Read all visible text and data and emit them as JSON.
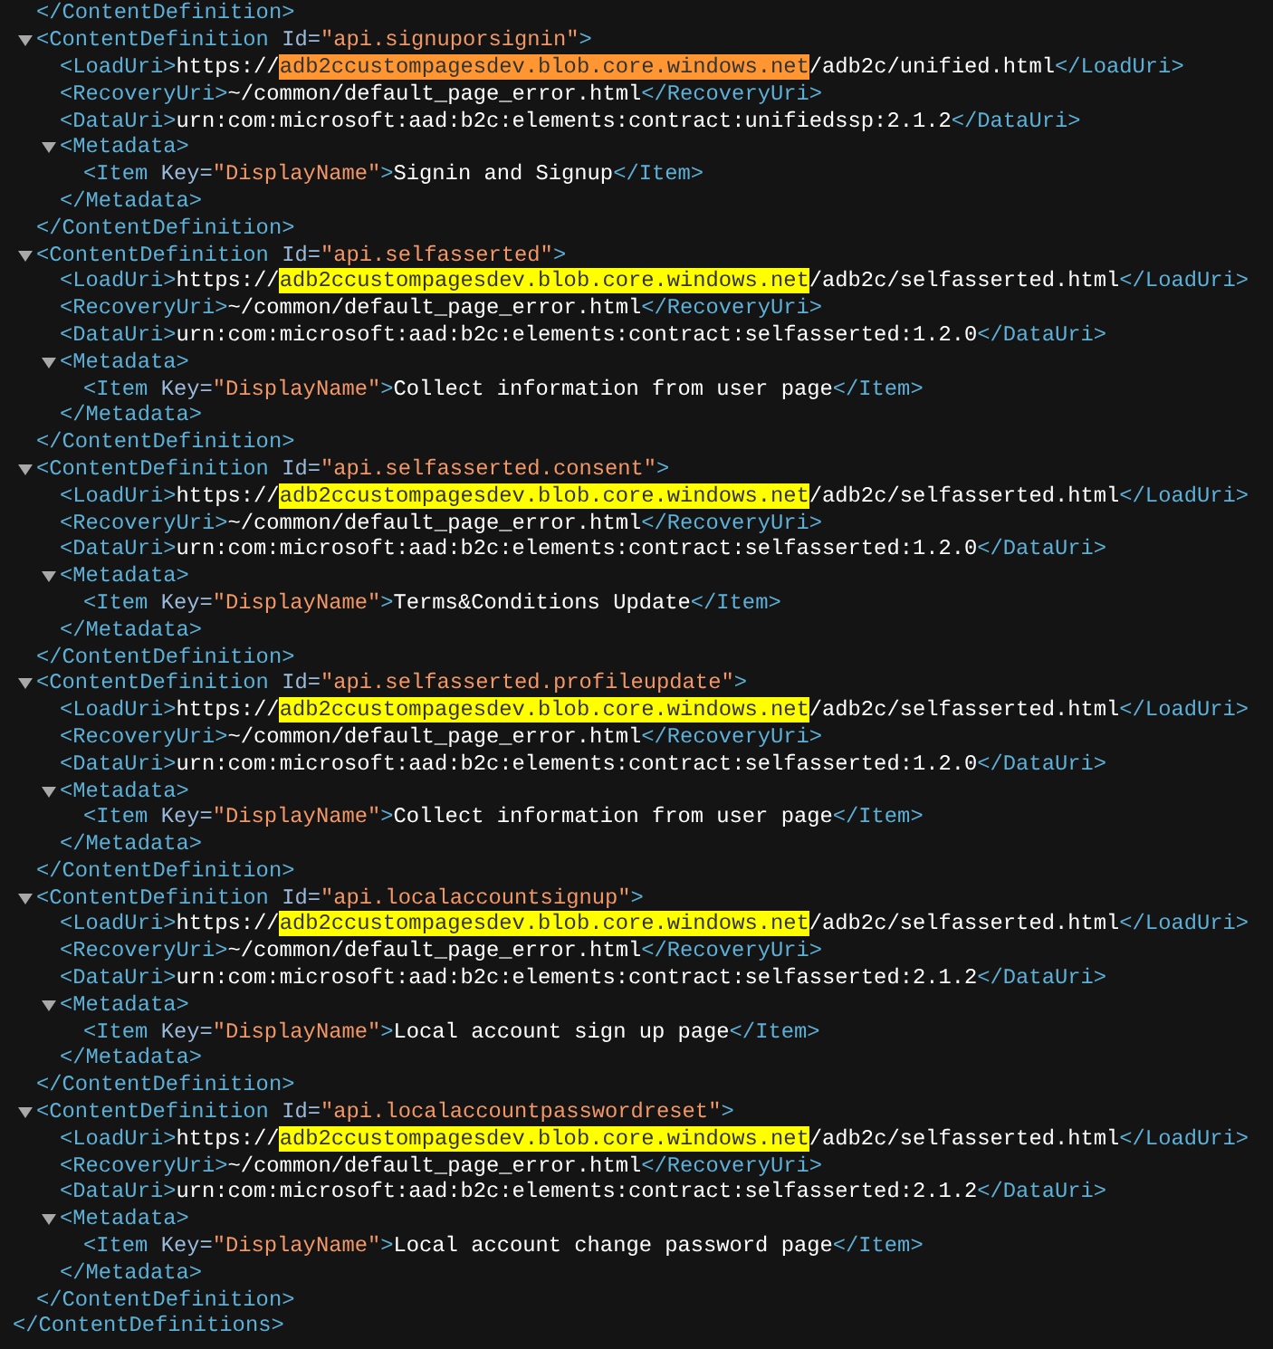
{
  "document": {
    "children": [
      {
        "kind": "line",
        "tokens": [
          {
            "kind": "tag",
            "text": "</ContentDefinition>"
          }
        ]
      },
      {
        "kind": "element",
        "expanded": true,
        "open": [
          {
            "kind": "tag",
            "text": "<ContentDefinition"
          },
          {
            "kind": "attr",
            "text": "Id="
          },
          {
            "kind": "value",
            "text": "\"api.signuporsignin\""
          },
          {
            "kind": "tag",
            "text": ">"
          }
        ],
        "children": [
          {
            "kind": "line",
            "tokens": [
              {
                "kind": "tag",
                "text": "<LoadUri>"
              },
              {
                "kind": "text",
                "text": "https://"
              },
              {
                "kind": "match",
                "text": "adb2ccustompagesdev.blob.core.windows.net",
                "selected": true
              },
              {
                "kind": "text",
                "text": "/adb2c/unified.html"
              },
              {
                "kind": "tag",
                "text": "</LoadUri>"
              }
            ]
          },
          {
            "kind": "line",
            "tokens": [
              {
                "kind": "tag",
                "text": "<RecoveryUri>"
              },
              {
                "kind": "text",
                "text": "~/common/default_page_error.html"
              },
              {
                "kind": "tag",
                "text": "</RecoveryUri>"
              }
            ]
          },
          {
            "kind": "line",
            "tokens": [
              {
                "kind": "tag",
                "text": "<DataUri>"
              },
              {
                "kind": "text",
                "text": "urn:com:microsoft:aad:b2c:elements:contract:unifiedssp:2.1.2"
              },
              {
                "kind": "tag",
                "text": "</DataUri>"
              }
            ]
          },
          {
            "kind": "element",
            "expanded": true,
            "open": [
              {
                "kind": "tag",
                "text": "<Metadata>"
              }
            ],
            "children": [
              {
                "kind": "line",
                "tokens": [
                  {
                    "kind": "tag",
                    "text": "<Item"
                  },
                  {
                    "kind": "attr",
                    "text": "Key="
                  },
                  {
                    "kind": "value",
                    "text": "\"DisplayName\""
                  },
                  {
                    "kind": "tag",
                    "text": ">"
                  },
                  {
                    "kind": "text",
                    "text": "Signin and Signup"
                  },
                  {
                    "kind": "tag",
                    "text": "</Item>"
                  }
                ]
              }
            ],
            "close": [
              {
                "kind": "tag",
                "text": "</Metadata>"
              }
            ]
          }
        ],
        "close": [
          {
            "kind": "tag",
            "text": "</ContentDefinition>"
          }
        ]
      },
      {
        "kind": "element",
        "expanded": true,
        "open": [
          {
            "kind": "tag",
            "text": "<ContentDefinition"
          },
          {
            "kind": "attr",
            "text": "Id="
          },
          {
            "kind": "value",
            "text": "\"api.selfasserted\""
          },
          {
            "kind": "tag",
            "text": ">"
          }
        ],
        "children": [
          {
            "kind": "line",
            "tokens": [
              {
                "kind": "tag",
                "text": "<LoadUri>"
              },
              {
                "kind": "text",
                "text": "https://"
              },
              {
                "kind": "match",
                "text": "adb2ccustompagesdev.blob.core.windows.net",
                "selected": false
              },
              {
                "kind": "text",
                "text": "/adb2c/selfasserted.html"
              },
              {
                "kind": "tag",
                "text": "</LoadUri>"
              }
            ]
          },
          {
            "kind": "line",
            "tokens": [
              {
                "kind": "tag",
                "text": "<RecoveryUri>"
              },
              {
                "kind": "text",
                "text": "~/common/default_page_error.html"
              },
              {
                "kind": "tag",
                "text": "</RecoveryUri>"
              }
            ]
          },
          {
            "kind": "line",
            "tokens": [
              {
                "kind": "tag",
                "text": "<DataUri>"
              },
              {
                "kind": "text",
                "text": "urn:com:microsoft:aad:b2c:elements:contract:selfasserted:1.2.0"
              },
              {
                "kind": "tag",
                "text": "</DataUri>"
              }
            ]
          },
          {
            "kind": "element",
            "expanded": true,
            "open": [
              {
                "kind": "tag",
                "text": "<Metadata>"
              }
            ],
            "children": [
              {
                "kind": "line",
                "tokens": [
                  {
                    "kind": "tag",
                    "text": "<Item"
                  },
                  {
                    "kind": "attr",
                    "text": "Key="
                  },
                  {
                    "kind": "value",
                    "text": "\"DisplayName\""
                  },
                  {
                    "kind": "tag",
                    "text": ">"
                  },
                  {
                    "kind": "text",
                    "text": "Collect information from user page"
                  },
                  {
                    "kind": "tag",
                    "text": "</Item>"
                  }
                ]
              }
            ],
            "close": [
              {
                "kind": "tag",
                "text": "</Metadata>"
              }
            ]
          }
        ],
        "close": [
          {
            "kind": "tag",
            "text": "</ContentDefinition>"
          }
        ]
      },
      {
        "kind": "element",
        "expanded": true,
        "open": [
          {
            "kind": "tag",
            "text": "<ContentDefinition"
          },
          {
            "kind": "attr",
            "text": "Id="
          },
          {
            "kind": "value",
            "text": "\"api.selfasserted.consent\""
          },
          {
            "kind": "tag",
            "text": ">"
          }
        ],
        "children": [
          {
            "kind": "line",
            "tokens": [
              {
                "kind": "tag",
                "text": "<LoadUri>"
              },
              {
                "kind": "text",
                "text": "https://"
              },
              {
                "kind": "match",
                "text": "adb2ccustompagesdev.blob.core.windows.net",
                "selected": false
              },
              {
                "kind": "text",
                "text": "/adb2c/selfasserted.html"
              },
              {
                "kind": "tag",
                "text": "</LoadUri>"
              }
            ]
          },
          {
            "kind": "line",
            "tokens": [
              {
                "kind": "tag",
                "text": "<RecoveryUri>"
              },
              {
                "kind": "text",
                "text": "~/common/default_page_error.html"
              },
              {
                "kind": "tag",
                "text": "</RecoveryUri>"
              }
            ]
          },
          {
            "kind": "line",
            "tokens": [
              {
                "kind": "tag",
                "text": "<DataUri>"
              },
              {
                "kind": "text",
                "text": "urn:com:microsoft:aad:b2c:elements:contract:selfasserted:1.2.0"
              },
              {
                "kind": "tag",
                "text": "</DataUri>"
              }
            ]
          },
          {
            "kind": "element",
            "expanded": true,
            "open": [
              {
                "kind": "tag",
                "text": "<Metadata>"
              }
            ],
            "children": [
              {
                "kind": "line",
                "tokens": [
                  {
                    "kind": "tag",
                    "text": "<Item"
                  },
                  {
                    "kind": "attr",
                    "text": "Key="
                  },
                  {
                    "kind": "value",
                    "text": "\"DisplayName\""
                  },
                  {
                    "kind": "tag",
                    "text": ">"
                  },
                  {
                    "kind": "text",
                    "text": "Terms&Conditions Update"
                  },
                  {
                    "kind": "tag",
                    "text": "</Item>"
                  }
                ]
              }
            ],
            "close": [
              {
                "kind": "tag",
                "text": "</Metadata>"
              }
            ]
          }
        ],
        "close": [
          {
            "kind": "tag",
            "text": "</ContentDefinition>"
          }
        ]
      },
      {
        "kind": "element",
        "expanded": true,
        "open": [
          {
            "kind": "tag",
            "text": "<ContentDefinition"
          },
          {
            "kind": "attr",
            "text": "Id="
          },
          {
            "kind": "value",
            "text": "\"api.selfasserted.profileupdate\""
          },
          {
            "kind": "tag",
            "text": ">"
          }
        ],
        "children": [
          {
            "kind": "line",
            "tokens": [
              {
                "kind": "tag",
                "text": "<LoadUri>"
              },
              {
                "kind": "text",
                "text": "https://"
              },
              {
                "kind": "match",
                "text": "adb2ccustompagesdev.blob.core.windows.net",
                "selected": false
              },
              {
                "kind": "text",
                "text": "/adb2c/selfasserted.html"
              },
              {
                "kind": "tag",
                "text": "</LoadUri>"
              }
            ]
          },
          {
            "kind": "line",
            "tokens": [
              {
                "kind": "tag",
                "text": "<RecoveryUri>"
              },
              {
                "kind": "text",
                "text": "~/common/default_page_error.html"
              },
              {
                "kind": "tag",
                "text": "</RecoveryUri>"
              }
            ]
          },
          {
            "kind": "line",
            "tokens": [
              {
                "kind": "tag",
                "text": "<DataUri>"
              },
              {
                "kind": "text",
                "text": "urn:com:microsoft:aad:b2c:elements:contract:selfasserted:1.2.0"
              },
              {
                "kind": "tag",
                "text": "</DataUri>"
              }
            ]
          },
          {
            "kind": "element",
            "expanded": true,
            "open": [
              {
                "kind": "tag",
                "text": "<Metadata>"
              }
            ],
            "children": [
              {
                "kind": "line",
                "tokens": [
                  {
                    "kind": "tag",
                    "text": "<Item"
                  },
                  {
                    "kind": "attr",
                    "text": "Key="
                  },
                  {
                    "kind": "value",
                    "text": "\"DisplayName\""
                  },
                  {
                    "kind": "tag",
                    "text": ">"
                  },
                  {
                    "kind": "text",
                    "text": "Collect information from user page"
                  },
                  {
                    "kind": "tag",
                    "text": "</Item>"
                  }
                ]
              }
            ],
            "close": [
              {
                "kind": "tag",
                "text": "</Metadata>"
              }
            ]
          }
        ],
        "close": [
          {
            "kind": "tag",
            "text": "</ContentDefinition>"
          }
        ]
      },
      {
        "kind": "element",
        "expanded": true,
        "open": [
          {
            "kind": "tag",
            "text": "<ContentDefinition"
          },
          {
            "kind": "attr",
            "text": "Id="
          },
          {
            "kind": "value",
            "text": "\"api.localaccountsignup\""
          },
          {
            "kind": "tag",
            "text": ">"
          }
        ],
        "children": [
          {
            "kind": "line",
            "tokens": [
              {
                "kind": "tag",
                "text": "<LoadUri>"
              },
              {
                "kind": "text",
                "text": "https://"
              },
              {
                "kind": "match",
                "text": "adb2ccustompagesdev.blob.core.windows.net",
                "selected": false
              },
              {
                "kind": "text",
                "text": "/adb2c/selfasserted.html"
              },
              {
                "kind": "tag",
                "text": "</LoadUri>"
              }
            ]
          },
          {
            "kind": "line",
            "tokens": [
              {
                "kind": "tag",
                "text": "<RecoveryUri>"
              },
              {
                "kind": "text",
                "text": "~/common/default_page_error.html"
              },
              {
                "kind": "tag",
                "text": "</RecoveryUri>"
              }
            ]
          },
          {
            "kind": "line",
            "tokens": [
              {
                "kind": "tag",
                "text": "<DataUri>"
              },
              {
                "kind": "text",
                "text": "urn:com:microsoft:aad:b2c:elements:contract:selfasserted:2.1.2"
              },
              {
                "kind": "tag",
                "text": "</DataUri>"
              }
            ]
          },
          {
            "kind": "element",
            "expanded": true,
            "open": [
              {
                "kind": "tag",
                "text": "<Metadata>"
              }
            ],
            "children": [
              {
                "kind": "line",
                "tokens": [
                  {
                    "kind": "tag",
                    "text": "<Item"
                  },
                  {
                    "kind": "attr",
                    "text": "Key="
                  },
                  {
                    "kind": "value",
                    "text": "\"DisplayName\""
                  },
                  {
                    "kind": "tag",
                    "text": ">"
                  },
                  {
                    "kind": "text",
                    "text": "Local account sign up page"
                  },
                  {
                    "kind": "tag",
                    "text": "</Item>"
                  }
                ]
              }
            ],
            "close": [
              {
                "kind": "tag",
                "text": "</Metadata>"
              }
            ]
          }
        ],
        "close": [
          {
            "kind": "tag",
            "text": "</ContentDefinition>"
          }
        ]
      },
      {
        "kind": "element",
        "expanded": true,
        "open": [
          {
            "kind": "tag",
            "text": "<ContentDefinition"
          },
          {
            "kind": "attr",
            "text": "Id="
          },
          {
            "kind": "value",
            "text": "\"api.localaccountpasswordreset\""
          },
          {
            "kind": "tag",
            "text": ">"
          }
        ],
        "children": [
          {
            "kind": "line",
            "tokens": [
              {
                "kind": "tag",
                "text": "<LoadUri>"
              },
              {
                "kind": "text",
                "text": "https://"
              },
              {
                "kind": "match",
                "text": "adb2ccustompagesdev.blob.core.windows.net",
                "selected": false
              },
              {
                "kind": "text",
                "text": "/adb2c/selfasserted.html"
              },
              {
                "kind": "tag",
                "text": "</LoadUri>"
              }
            ]
          },
          {
            "kind": "line",
            "tokens": [
              {
                "kind": "tag",
                "text": "<RecoveryUri>"
              },
              {
                "kind": "text",
                "text": "~/common/default_page_error.html"
              },
              {
                "kind": "tag",
                "text": "</RecoveryUri>"
              }
            ]
          },
          {
            "kind": "line",
            "tokens": [
              {
                "kind": "tag",
                "text": "<DataUri>"
              },
              {
                "kind": "text",
                "text": "urn:com:microsoft:aad:b2c:elements:contract:selfasserted:2.1.2"
              },
              {
                "kind": "tag",
                "text": "</DataUri>"
              }
            ]
          },
          {
            "kind": "element",
            "expanded": true,
            "open": [
              {
                "kind": "tag",
                "text": "<Metadata>"
              }
            ],
            "children": [
              {
                "kind": "line",
                "tokens": [
                  {
                    "kind": "tag",
                    "text": "<Item"
                  },
                  {
                    "kind": "attr",
                    "text": "Key="
                  },
                  {
                    "kind": "value",
                    "text": "\"DisplayName\""
                  },
                  {
                    "kind": "tag",
                    "text": ">"
                  },
                  {
                    "kind": "text",
                    "text": "Local account change password page"
                  },
                  {
                    "kind": "tag",
                    "text": "</Item>"
                  }
                ]
              }
            ],
            "close": [
              {
                "kind": "tag",
                "text": "</Metadata>"
              }
            ]
          }
        ],
        "close": [
          {
            "kind": "tag",
            "text": "</ContentDefinition>"
          }
        ]
      }
    ],
    "close": [
      {
        "kind": "tag",
        "text": "</ContentDefinitions>"
      }
    ]
  }
}
